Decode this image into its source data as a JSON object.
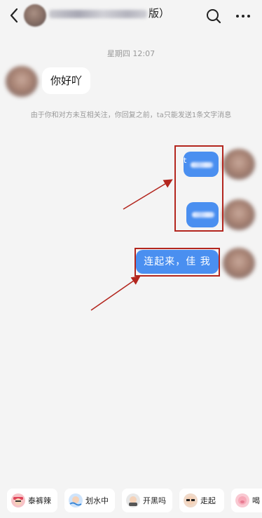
{
  "header": {
    "title_suffix": "版）"
  },
  "chat": {
    "timestamp": "星期四 12:07",
    "incoming_message": "你好吖",
    "notice": "由于你和对方未互相关注，你回复之前，ta只能发送1条文字消息",
    "outgoing_first_char": "t",
    "outgoing_message": "连起来，佳 我"
  },
  "quick_replies": [
    {
      "label": "泰裤辣",
      "icon": "emoji-cool-icon"
    },
    {
      "label": "划水中",
      "icon": "emoji-swim-icon"
    },
    {
      "label": "开黑吗",
      "icon": "emoji-game-icon"
    },
    {
      "label": "走起",
      "icon": "emoji-sunglasses-icon"
    },
    {
      "label": "喝",
      "icon": "emoji-pig-icon"
    }
  ],
  "colors": {
    "bubble_blue": "#4a8ff0",
    "annotation_red": "#b3261e",
    "background": "#f4f4f4"
  }
}
